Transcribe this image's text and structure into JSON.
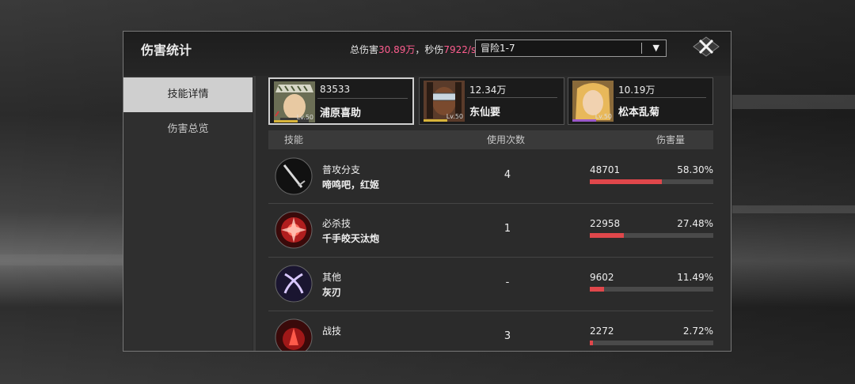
{
  "header": {
    "title": "伤害统计",
    "total_label": "总伤害",
    "total_value": "30.89万",
    "dps_label": "，秒伤",
    "dps_value": "7922/s",
    "stage": "冒险1-7"
  },
  "sidebar": {
    "tabs": [
      {
        "label": "技能详情",
        "active": true
      },
      {
        "label": "伤害总览",
        "active": false
      }
    ]
  },
  "characters": [
    {
      "damage": "83533",
      "name": "浦原喜助",
      "level": "Lv.50",
      "selected": true
    },
    {
      "damage": "12.34万",
      "name": "东仙要",
      "level": "Lv.50",
      "selected": false
    },
    {
      "damage": "10.19万",
      "name": "松本乱菊",
      "level": "Lv.50",
      "selected": false
    }
  ],
  "table": {
    "col_skill": "技能",
    "col_uses": "使用次数",
    "col_damage": "伤害量",
    "rows": [
      {
        "type": "普攻分支",
        "name": "啼鸣吧，红姬",
        "uses": "4",
        "damage": "48701",
        "percent": "58.30%",
        "fraction": 0.583,
        "icon": "sword-icon"
      },
      {
        "type": "必杀技",
        "name": "千手皎天汰炮",
        "uses": "1",
        "damage": "22958",
        "percent": "27.48%",
        "fraction": 0.2748,
        "icon": "explosion-icon"
      },
      {
        "type": "其他",
        "name": "灰刃",
        "uses": "-",
        "damage": "9602",
        "percent": "11.49%",
        "fraction": 0.1149,
        "icon": "crossed-blades-icon"
      },
      {
        "type": "战技",
        "name": "",
        "uses": "3",
        "damage": "2272",
        "percent": "2.72%",
        "fraction": 0.0272,
        "icon": "burst-icon"
      }
    ]
  },
  "colors": {
    "accent": "#ff5d8f",
    "bar": "#e0474b"
  }
}
